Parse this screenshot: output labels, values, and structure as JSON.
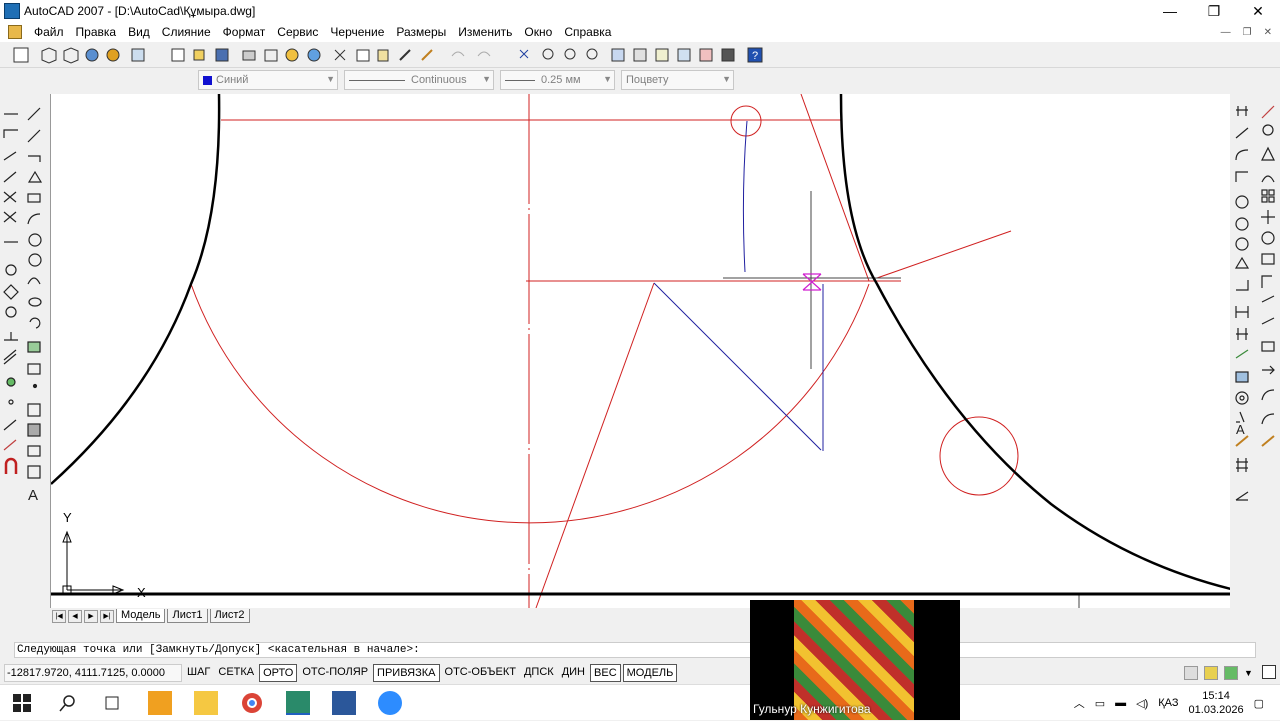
{
  "window": {
    "title": "AutoCAD 2007 - [D:\\AutoCad\\Құмыра.dwg]",
    "minimize": "—",
    "restore": "❐",
    "close": "✕"
  },
  "menu": {
    "items": [
      "Файл",
      "Правка",
      "Вид",
      "Слияние",
      "Формат",
      "Сервис",
      "Черчение",
      "Размеры",
      "Изменить",
      "Окно",
      "Справка"
    ],
    "mdi_minimize": "—",
    "mdi_restore": "❐",
    "mdi_close": "✕"
  },
  "properties": {
    "color": "Синий",
    "color_hex": "#1010d0",
    "linetype": "Continuous",
    "lineweight": "0.25 мм",
    "plotstyle": "Поцвету"
  },
  "drawing": {
    "background": "#ffffff",
    "red_lines": "#d02020",
    "blue_lines": "#2020a0",
    "ucs": {
      "y_label": "Y",
      "x_label": "X"
    }
  },
  "layout_tabs": [
    "Модель",
    "Лист1",
    "Лист2"
  ],
  "command": {
    "prompt": "Следующая точка или [Замкнуть/Допуск] <касательная в начале>:"
  },
  "status": {
    "coordinates": "-12817.9720, 4111.7125, 0.0000",
    "toggles": [
      {
        "label": "ШАГ",
        "on": false
      },
      {
        "label": "СЕТКА",
        "on": false
      },
      {
        "label": "ОРТО",
        "on": true
      },
      {
        "label": "ОТС-ПОЛЯР",
        "on": false
      },
      {
        "label": "ПРИВЯЗКА",
        "on": true
      },
      {
        "label": "ОТС-ОБЪЕКТ",
        "on": false
      },
      {
        "label": "ДПСК",
        "on": false
      },
      {
        "label": "ДИН",
        "on": false
      },
      {
        "label": "ВЕС",
        "on": true
      },
      {
        "label": "МОДЕЛЬ",
        "on": true
      }
    ]
  },
  "webcam": {
    "name": "Гульнур Кунжигитова"
  },
  "taskbar": {
    "language": "ҚАЗ",
    "time": "15:14",
    "date": "01.03.2026"
  }
}
